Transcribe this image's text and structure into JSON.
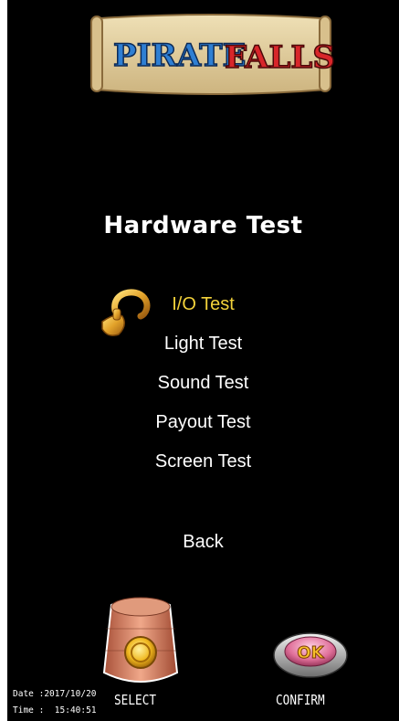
{
  "logo": {
    "word1": "PIRATE",
    "word2": "FALLS"
  },
  "title": "Hardware Test",
  "menu": {
    "selected_index": 0,
    "items": [
      {
        "label": "I/O Test"
      },
      {
        "label": "Light Test"
      },
      {
        "label": "Sound Test"
      },
      {
        "label": "Payout Test"
      },
      {
        "label": "Screen Test"
      }
    ]
  },
  "back_label": "Back",
  "controls": {
    "select_label": "SELECT",
    "confirm_label": "CONFIRM",
    "ok_icon_text": "OK"
  },
  "status": {
    "date_label": "Date :",
    "date_value": "2017/10/20",
    "time_label": "Time :",
    "time_value": "15:40:51"
  },
  "colors": {
    "background": "#000000",
    "selected": "#f3d23b",
    "text": "#ffffff"
  }
}
